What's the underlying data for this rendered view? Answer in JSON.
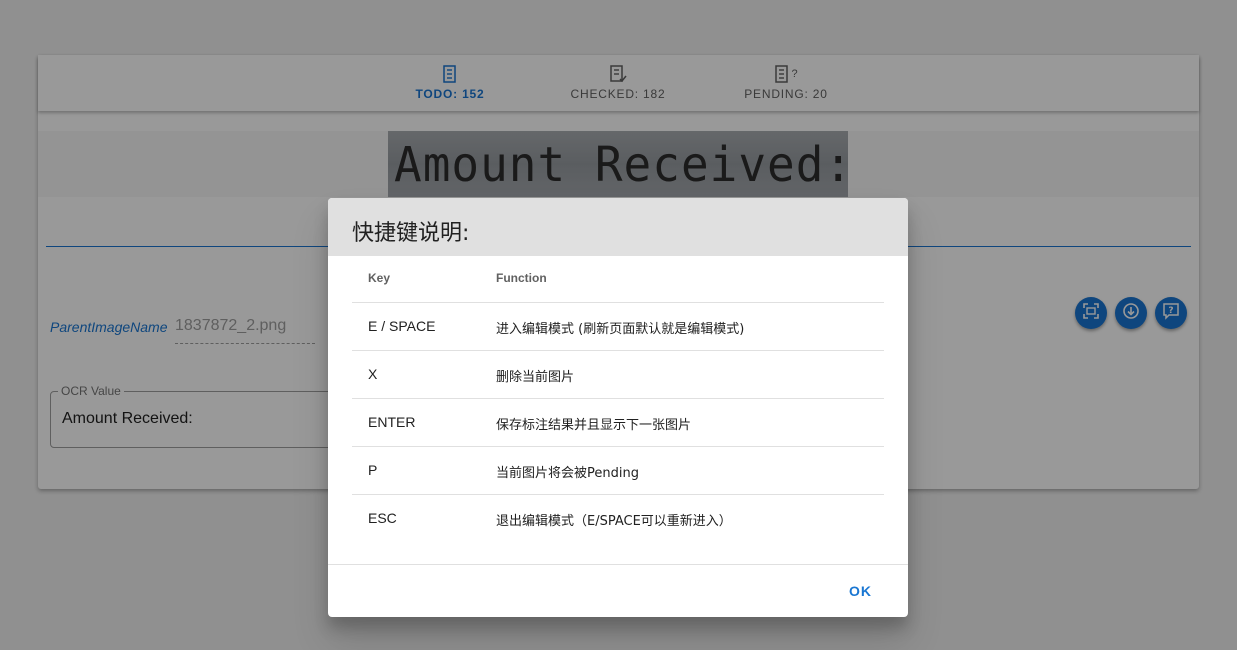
{
  "tabs": [
    {
      "label": "TODO: 152",
      "icon": "todo-list-icon",
      "active": true
    },
    {
      "label": "CHECKED: 182",
      "icon": "checked-list-icon",
      "active": false
    },
    {
      "label": "PENDING: 20",
      "icon": "pending-list-icon",
      "suffix": "?",
      "active": false
    }
  ],
  "ocr_image": {
    "text": "Amount Received:"
  },
  "fields": {
    "parent_image_label": "ParentImageName",
    "parent_image_value": "1837872_2.png",
    "ocr_value_legend": "OCR Value",
    "ocr_value": "Amount Received:"
  },
  "actions": [
    {
      "icon": "scan-icon"
    },
    {
      "icon": "download-circle-icon"
    },
    {
      "icon": "help-comment-icon"
    }
  ],
  "dialog": {
    "title": "快捷键说明:",
    "columns": {
      "key": "Key",
      "function": "Function"
    },
    "rows": [
      {
        "key": "E / SPACE",
        "function": "进入编辑模式 (刷新页面默认就是编辑模式)"
      },
      {
        "key": "X",
        "function": "删除当前图片"
      },
      {
        "key": "ENTER",
        "function": "保存标注结果并且显示下一张图片"
      },
      {
        "key": "P",
        "function": "当前图片将会被Pending"
      },
      {
        "key": "ESC",
        "function": "退出编辑模式（E/SPACE可以重新进入）"
      }
    ],
    "ok_label": "OK"
  },
  "colors": {
    "accent": "#1976d2",
    "header_bg": "#e0e0e0"
  }
}
